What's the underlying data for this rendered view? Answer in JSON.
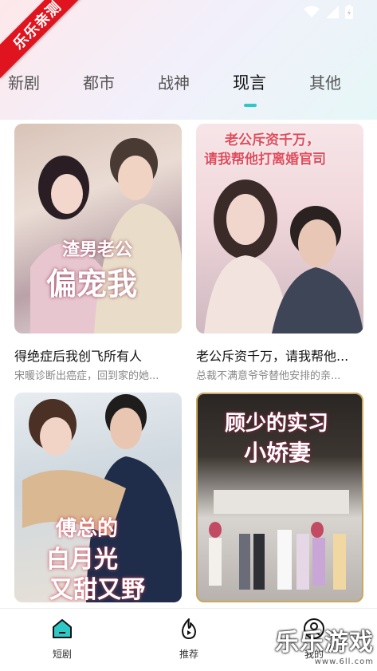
{
  "ribbon": "乐乐亲测",
  "tabs": [
    {
      "label": "新剧"
    },
    {
      "label": "都市"
    },
    {
      "label": "战神"
    },
    {
      "label": "现言"
    },
    {
      "label": "其他"
    }
  ],
  "active_tab": "现言",
  "cards": [
    {
      "title": "得绝症后我创飞所有人",
      "desc": "宋暖诊断出癌症，回到家的她...",
      "poster_text": [
        "渣男老公",
        "偏宠我"
      ]
    },
    {
      "title": "老公斥资千万，请我帮他...",
      "desc": "总裁不满意爷爷替他安排的亲...",
      "poster_text": [
        "老公斥资千万，",
        "请我帮他打离婚官司"
      ]
    },
    {
      "title": "",
      "desc": "",
      "poster_text": [
        "傅总的",
        "白月光",
        "又甜又野"
      ]
    },
    {
      "title": "",
      "desc": "",
      "poster_text": [
        "顾少的实习",
        "小娇妻"
      ]
    }
  ],
  "nav": [
    {
      "label": "短剧",
      "icon": "home-icon"
    },
    {
      "label": "推荐",
      "icon": "flame-play-icon"
    },
    {
      "label": "我的",
      "icon": "user-icon"
    }
  ],
  "watermark": {
    "text": "乐乐游戏",
    "sub": "www.6ll.com"
  },
  "colors": {
    "accent": "#2ec8c6",
    "ribbon": "#e0141e"
  }
}
